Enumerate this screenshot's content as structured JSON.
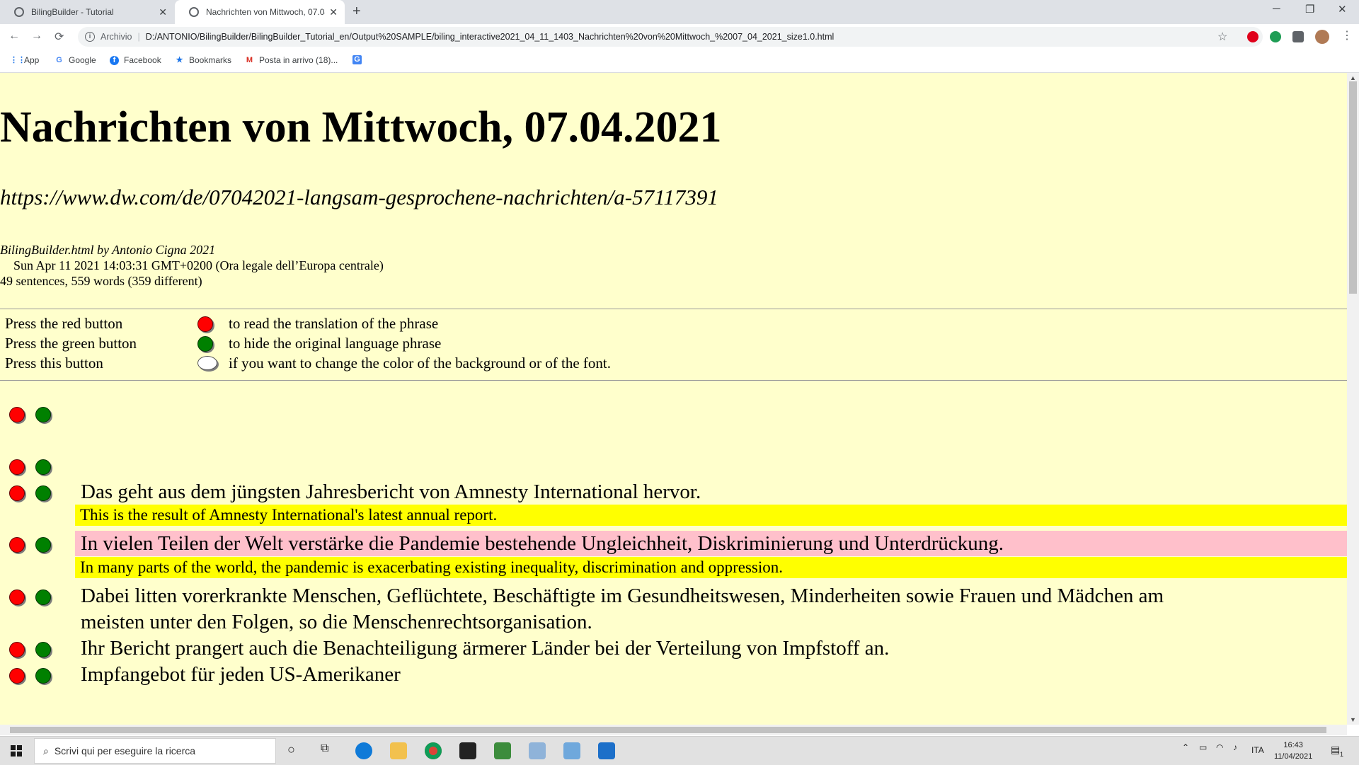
{
  "browser": {
    "tabs": [
      {
        "title": "BilingBuilder - Tutorial",
        "close": "✕"
      },
      {
        "title": "Nachrichten von Mittwoch, 07.04.2021",
        "close": "✕"
      }
    ],
    "new_tab": "+",
    "window_controls": [
      "─",
      "❐",
      "✕"
    ],
    "nav": {
      "back": "←",
      "forward": "→",
      "reload": "⟳"
    },
    "address": {
      "scheme": "Archivio",
      "url": "D:/ANTONIO/BilingBuilder/BilingBuilder_Tutorial_en/Output%20SAMPLE/biling_interactive2021_04_11_1403_Nachrichten%20von%20Mittwoch_%2007_04_2021_size1.0.html"
    },
    "star": "☆",
    "bookmarks": [
      {
        "label": "App",
        "icon": "apps-grid-icon"
      },
      {
        "label": "Google",
        "icon": "google-icon"
      },
      {
        "label": "Facebook",
        "icon": "facebook-icon"
      },
      {
        "label": "Bookmarks",
        "icon": "star-icon"
      },
      {
        "label": "Posta in arrivo (18)...",
        "icon": "gmail-icon"
      },
      {
        "label": "",
        "icon": "translate-icon"
      }
    ]
  },
  "page": {
    "title": "Nachrichten von Mittwoch, 07.04.2021",
    "source": "https://www.dw.com/de/07042021-langsam-gesprochene-nachrichten/a-57117391",
    "credit": "BilingBuilder.html by Antonio Cigna 2021",
    "date": "Sun Apr 11 2021 14:03:31 GMT+0200 (Ora legale dell’Europa centrale)",
    "stats": "49 sentences, 559 words (359 different)",
    "legend": [
      {
        "label": "Press the red button",
        "color": "red",
        "text": "to read the translation of the phrase"
      },
      {
        "label": "Press the green button",
        "color": "green",
        "text": "to hide the original language phrase"
      },
      {
        "label": "Press this button",
        "color": "white",
        "text": "if you want to change the color of the background or of the font."
      }
    ],
    "sentences": [
      {
        "orig": "",
        "trans": ""
      },
      {
        "orig": "",
        "trans": ""
      },
      {
        "orig": "Das geht aus dem jüngsten Jahresbericht von Amnesty International hervor.",
        "trans": "This is the result of Amnesty International's latest annual report."
      },
      {
        "orig": "In vielen Teilen der Welt verstärke die Pandemie bestehende Ungleichheit, Diskriminierung und Unterdrückung.",
        "trans": "In many parts of the world, the pandemic is exacerbating existing inequality, discrimination and oppression.",
        "highlight": true
      },
      {
        "orig": "Dabei litten vorerkrankte Menschen, Geflüchtete, Beschäftigte im Gesundheitswesen, Minderheiten sowie Frauen und Mädchen am",
        "orig2": "meisten unter den Folgen, so die Menschenrechtsorganisation."
      },
      {
        "orig": "Ihr Bericht prangert auch die Benachteiligung ärmerer Länder bei der Verteilung von Impfstoff an."
      },
      {
        "orig": "Impfangebot für jeden US-Amerikaner"
      }
    ]
  },
  "taskbar": {
    "search_placeholder": "Scrivi qui per eseguire la ricerca",
    "lang": "ITA",
    "time": "16:43",
    "date": "11/04/2021",
    "notifications": "1"
  },
  "colors": {
    "page_bg": "#ffffcc",
    "translation_bg": "#ffff00",
    "highlight_bg": "#ffc0cb"
  }
}
